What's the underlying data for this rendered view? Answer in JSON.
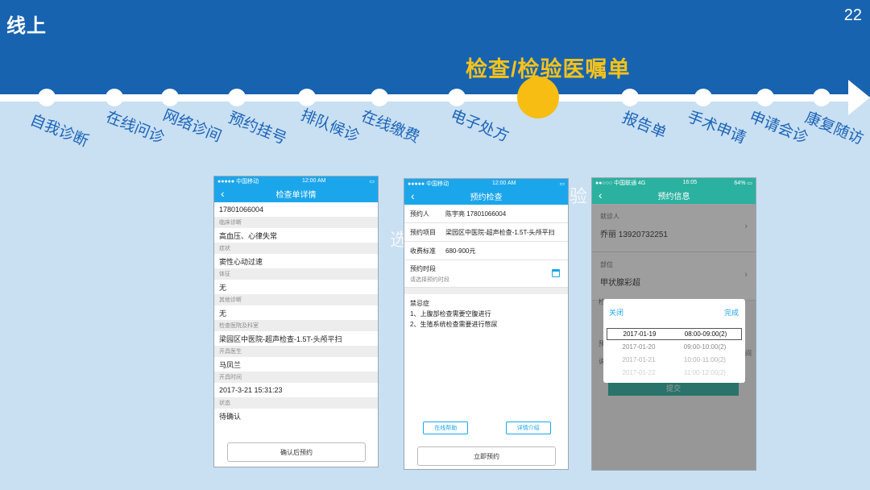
{
  "slide": {
    "title": "线上",
    "page_number": "22",
    "highlight": "检查/检验医嘱单"
  },
  "timeline_steps": [
    "自我诊断",
    "在线问诊",
    "网络诊间",
    "预约挂号",
    "排队候诊",
    "在线缴费",
    "电子处方",
    "报告单",
    "手术申请",
    "申请会诊",
    "康复随访"
  ],
  "watermark": {
    "left": "选",
    "right": "验"
  },
  "phone1": {
    "status": {
      "carrier": "●●●●● 中国移动",
      "time": "12:00 AM",
      "battery": "▭"
    },
    "title": "检查单详情",
    "rows": [
      {
        "label": "",
        "value": "17801066004"
      },
      {
        "label": "临床诊断",
        "value": "高血压、心律失常"
      },
      {
        "label": "症状",
        "value": "窦性心动过速"
      },
      {
        "label": "体征",
        "value": "无"
      },
      {
        "label": "其他诊断",
        "value": "无"
      },
      {
        "label": "检查医院及科室",
        "value": "梁园区中医院-超声检查-1.5T-头颅平扫"
      },
      {
        "label": "开具医生",
        "value": "马凤兰"
      },
      {
        "label": "开具时间",
        "value": "2017-3-21  15:31:23"
      },
      {
        "label": "状态",
        "value": "待确认"
      }
    ],
    "button": "确认后预约"
  },
  "phone2": {
    "status": {
      "carrier": "●●●●● 中国移动",
      "time": "12:00 AM",
      "battery": "▭"
    },
    "title": "预约检查",
    "fields": [
      {
        "key": "预约人",
        "value": "陈宇亮  17801066004"
      },
      {
        "key": "预约项目",
        "value": "梁园区中医院-超声检查-1.5T-头颅平扫"
      },
      {
        "key": "收费标准",
        "value": "680-900元"
      }
    ],
    "slot_title": "预约时段",
    "slot_placeholder": "请选择预约时段",
    "contra_title": "禁忌症",
    "contra_items": [
      "1、上腹部检查需要空腹进行",
      "2、生殖系统检查需要进行憋尿"
    ],
    "help_button": "在线帮助",
    "detail_button": "详情介绍",
    "book_button": "立即预约"
  },
  "phone3": {
    "status": {
      "carrier": "●●○○○ 中国联通  4G",
      "time": "16:05",
      "battery": "64% ▭"
    },
    "title": "预约信息",
    "patient_label": "就诊人",
    "patient_value": "乔丽  13920732251",
    "part_label": "部位",
    "part_value": "甲状腺彩超",
    "obscured_1": "检",
    "obscured_2": "预",
    "obscured_3": "说",
    "obscured_4": "间",
    "submit": "提交",
    "picker": {
      "close": "关闭",
      "done": "完成",
      "rows": [
        {
          "date": "2017-01-19",
          "time": "08:00-09:00(2)"
        },
        {
          "date": "2017-01-20",
          "time": "09:00-10:00(2)"
        },
        {
          "date": "2017-01-21",
          "time": "10:00-11:00(2)"
        },
        {
          "date": "2017-01-22",
          "time": "11:00-12:00(2)"
        }
      ]
    }
  }
}
